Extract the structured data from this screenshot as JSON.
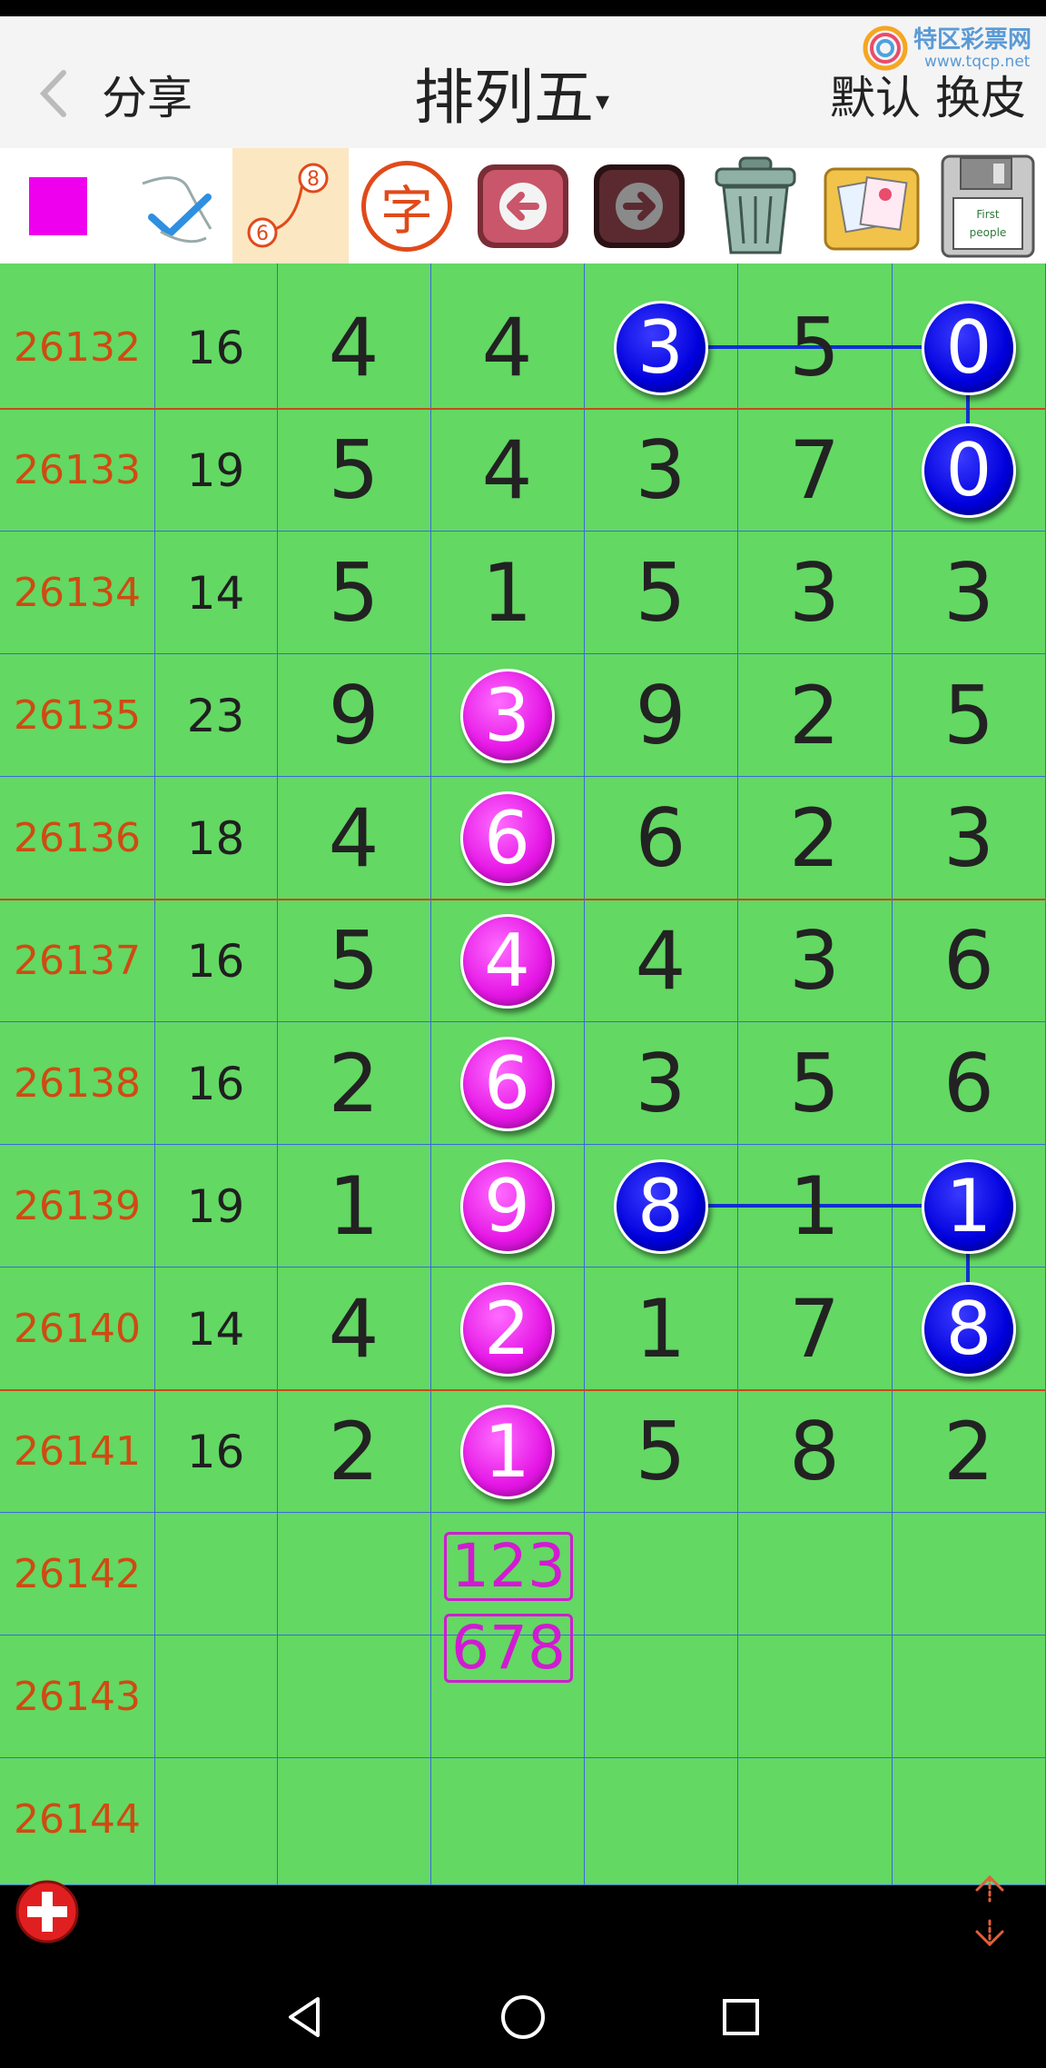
{
  "header": {
    "share_label": "分享",
    "title": "排列五",
    "title_caret": "▾",
    "default_label": "默认",
    "skin_label": "换皮",
    "logo_text": "特区彩票网",
    "logo_url": "www.tqcp.net"
  },
  "toolbar": {
    "color_swatch": "#ee00ee",
    "connect_tool": {
      "top": "8",
      "bottom": "6"
    },
    "text_tool_label": "字",
    "floppy_label_1": "First",
    "floppy_label_2": "people"
  },
  "rows": [
    {
      "issue": "26132",
      "sum": "16",
      "d": [
        "4",
        "4",
        "3",
        "5",
        "0"
      ]
    },
    {
      "issue": "26133",
      "sum": "19",
      "d": [
        "5",
        "4",
        "3",
        "7",
        "0"
      ]
    },
    {
      "issue": "26134",
      "sum": "14",
      "d": [
        "5",
        "1",
        "5",
        "3",
        "3"
      ]
    },
    {
      "issue": "26135",
      "sum": "23",
      "d": [
        "9",
        "3",
        "9",
        "2",
        "5"
      ]
    },
    {
      "issue": "26136",
      "sum": "18",
      "d": [
        "4",
        "6",
        "6",
        "2",
        "3"
      ]
    },
    {
      "issue": "26137",
      "sum": "16",
      "d": [
        "5",
        "4",
        "4",
        "3",
        "6"
      ]
    },
    {
      "issue": "26138",
      "sum": "16",
      "d": [
        "2",
        "6",
        "3",
        "5",
        "6"
      ]
    },
    {
      "issue": "26139",
      "sum": "19",
      "d": [
        "1",
        "9",
        "8",
        "1",
        "1"
      ]
    },
    {
      "issue": "26140",
      "sum": "14",
      "d": [
        "4",
        "2",
        "1",
        "7",
        "8"
      ]
    },
    {
      "issue": "26141",
      "sum": "16",
      "d": [
        "2",
        "1",
        "5",
        "8",
        "2"
      ]
    },
    {
      "issue": "26142",
      "sum": "",
      "d": [
        "",
        "",
        "",
        "",
        ""
      ]
    },
    {
      "issue": "26143",
      "sum": "",
      "d": [
        "",
        "",
        "",
        "",
        ""
      ]
    },
    {
      "issue": "26144",
      "sum": "",
      "d": [
        "",
        "",
        "",
        "",
        ""
      ]
    }
  ],
  "prediction": {
    "line1": "123",
    "line2": "678"
  },
  "colors": {
    "grid_bg": "#63d863",
    "pink_ball": "#e516e5",
    "blue_ball": "#0000dd",
    "issue_text": "#d04a12"
  }
}
